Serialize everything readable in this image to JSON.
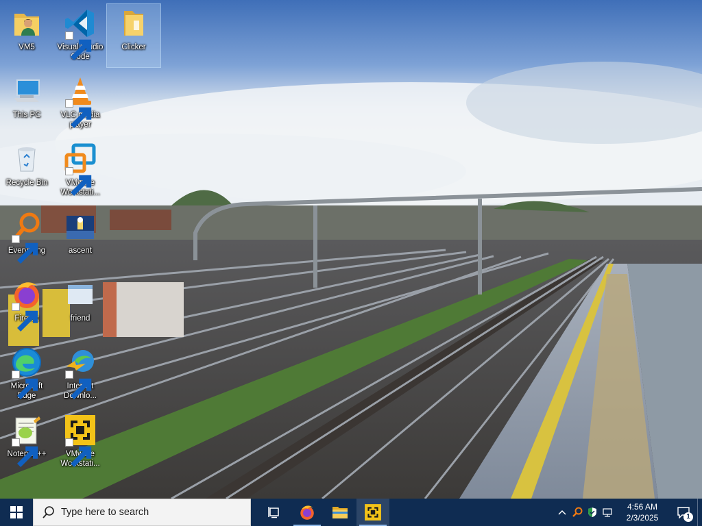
{
  "desktop": {
    "icons": [
      {
        "label": "VM5",
        "icon": "user-folder-icon"
      },
      {
        "label": "Visual Studio Code",
        "icon": "vscode-icon"
      },
      {
        "label": "Clicker",
        "icon": "folder-icon"
      },
      {
        "label": "This PC",
        "icon": "computer-icon"
      },
      {
        "label": "VLC media player",
        "icon": "vlc-icon"
      },
      {
        "label": "Recycle Bin",
        "icon": "recycle-bin-icon"
      },
      {
        "label": "VMware Workstati...",
        "icon": "vmware-icon"
      },
      {
        "label": "Everything",
        "icon": "everything-search-icon"
      },
      {
        "label": "ascent",
        "icon": "ascent-icon"
      },
      {
        "label": "Firefox",
        "icon": "firefox-icon"
      },
      {
        "label": "friend",
        "icon": "friend-icon"
      },
      {
        "label": "Microsoft Edge",
        "icon": "edge-icon"
      },
      {
        "label": "Internet Downlo...",
        "icon": "internet-download-manager-icon"
      },
      {
        "label": "Notepad++",
        "icon": "notepadpp-icon"
      },
      {
        "label": "VMware Workstati...",
        "icon": "vmware-workstation-pro-icon"
      }
    ],
    "selected_icon": "Clicker"
  },
  "taskbar": {
    "search_placeholder": "Type here to search",
    "pinned": [
      {
        "name": "task-view",
        "icon": "task-view-icon",
        "running": false
      },
      {
        "name": "firefox",
        "icon": "firefox-icon",
        "running": true
      },
      {
        "name": "file-explorer",
        "icon": "file-explorer-icon",
        "running": false
      },
      {
        "name": "vmware",
        "icon": "vmware-icon",
        "running": true
      }
    ],
    "clock": {
      "time": "4:56 AM",
      "date": "2/3/2025"
    },
    "notification_count": "1"
  },
  "colors": {
    "taskbar": "#0f2c52",
    "search_bg": "#f3f3f3",
    "accent": "#0078d4"
  }
}
